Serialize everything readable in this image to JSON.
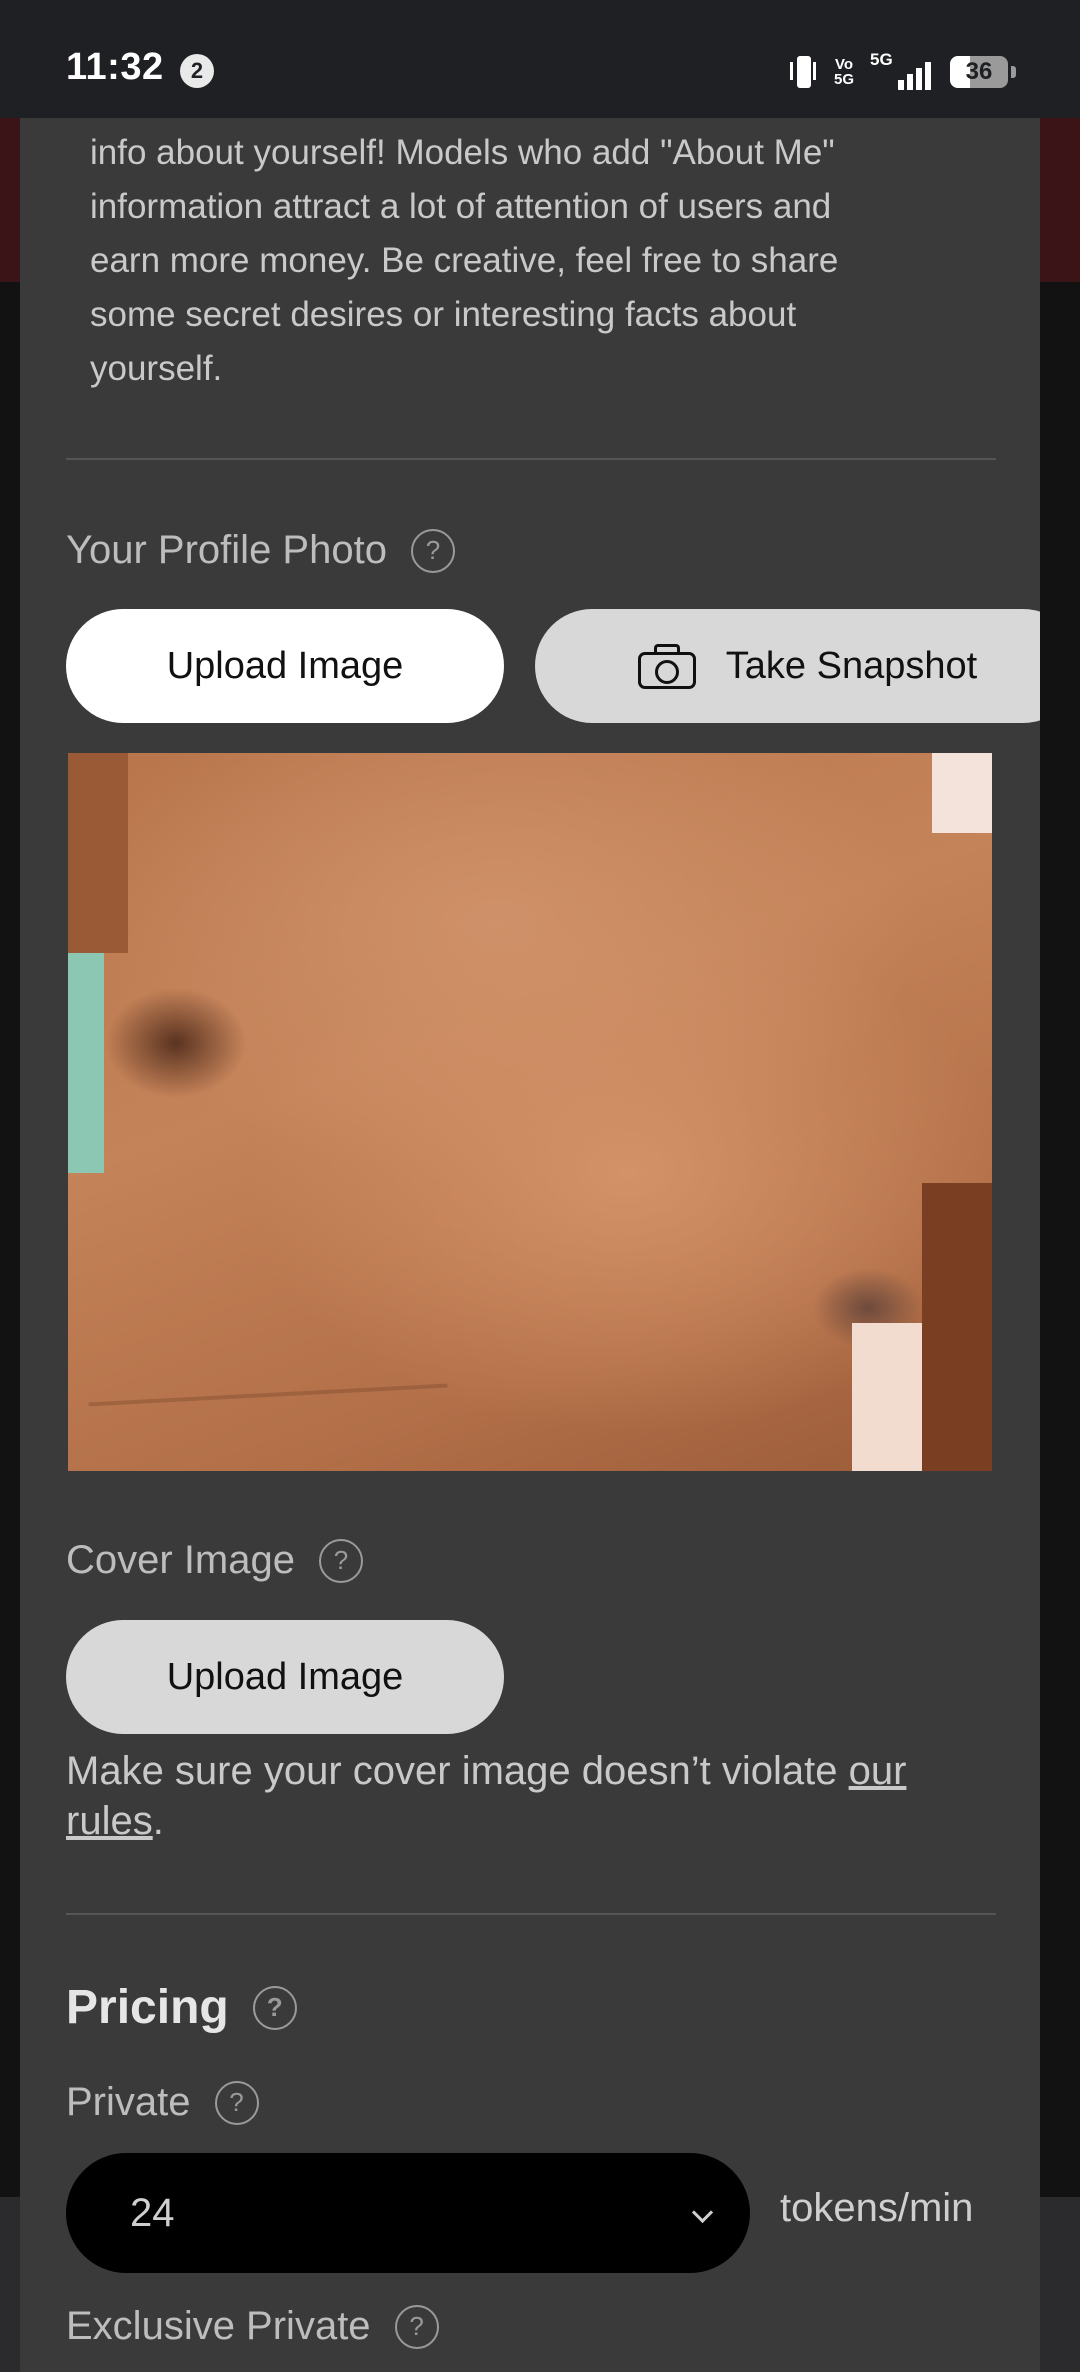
{
  "status_bar": {
    "time": "11:32",
    "notification_count": "2",
    "volte_line1": "Vo",
    "volte_line2": "5G",
    "network": "5G",
    "battery": "36"
  },
  "about": {
    "text_lines": [
      "info about yourself! Models who add \"About Me\"",
      "information attract a lot of attention of users and",
      "earn more money. Be creative, feel free to share",
      "some secret desires or interesting facts about",
      "yourself."
    ]
  },
  "profile_photo": {
    "label": "Your Profile Photo",
    "upload_label": "Upload Image",
    "snapshot_label": "Take Snapshot"
  },
  "cover_image": {
    "label": "Cover Image",
    "upload_label": "Upload Image",
    "note_prefix": "Make sure your cover image doesn’t violate",
    "note_link": "our rules",
    "note_suffix": "."
  },
  "pricing": {
    "title": "Pricing",
    "private_label": "Private",
    "private_value": "24",
    "unit": "tokens/min",
    "exclusive_label": "Exclusive Private"
  },
  "help_glyph": "?"
}
